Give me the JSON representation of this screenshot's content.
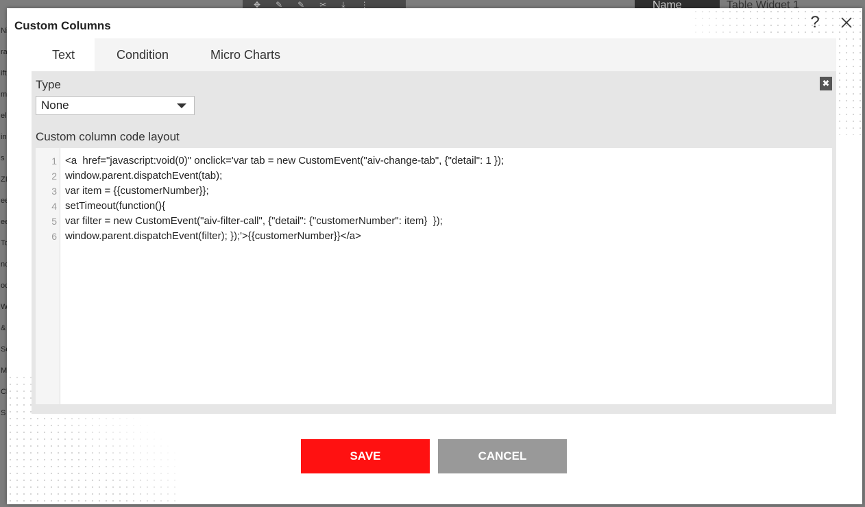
{
  "background": {
    "tab_name": "Name",
    "tab_title": "Table Widget 1",
    "left_list": [
      "Ni",
      "ra",
      "ift",
      "m",
      "el",
      "in",
      "s",
      "ZI",
      "ee",
      "ee",
      "To",
      "nc",
      "oc",
      "Wl",
      "&",
      "Sc",
      "Ma",
      "Cl",
      "S"
    ]
  },
  "modal": {
    "title": "Custom Columns",
    "help_symbol": "?",
    "tabs": [
      {
        "label": "Text",
        "active": true
      },
      {
        "label": "Condition",
        "active": false
      },
      {
        "label": "Micro Charts",
        "active": false
      }
    ],
    "type_label": "Type",
    "type_selected": "None",
    "panel_close_symbol": "✖",
    "code_label": "Custom column code layout",
    "code_lines": [
      {
        "n": "1",
        "text": "<a  href=\"javascript:void(0)\" onclick='var tab = new CustomEvent(\"aiv-change-tab\", {\"detail\": 1 });"
      },
      {
        "n": "2",
        "text": "window.parent.dispatchEvent(tab);"
      },
      {
        "n": "3",
        "text": "var item = {{customerNumber}};"
      },
      {
        "n": "4",
        "text": "setTimeout(function(){"
      },
      {
        "n": "5",
        "text": "var filter = new CustomEvent(\"aiv-filter-call\", {\"detail\": {\"customerNumber\": item}  });"
      },
      {
        "n": "6",
        "text": "window.parent.dispatchEvent(filter); });'>{{customerNumber}}</a>"
      }
    ],
    "save_label": "SAVE",
    "cancel_label": "CANCEL"
  },
  "colors": {
    "save": "#ff1111",
    "cancel": "#999999",
    "panel": "#e6e6e6"
  }
}
